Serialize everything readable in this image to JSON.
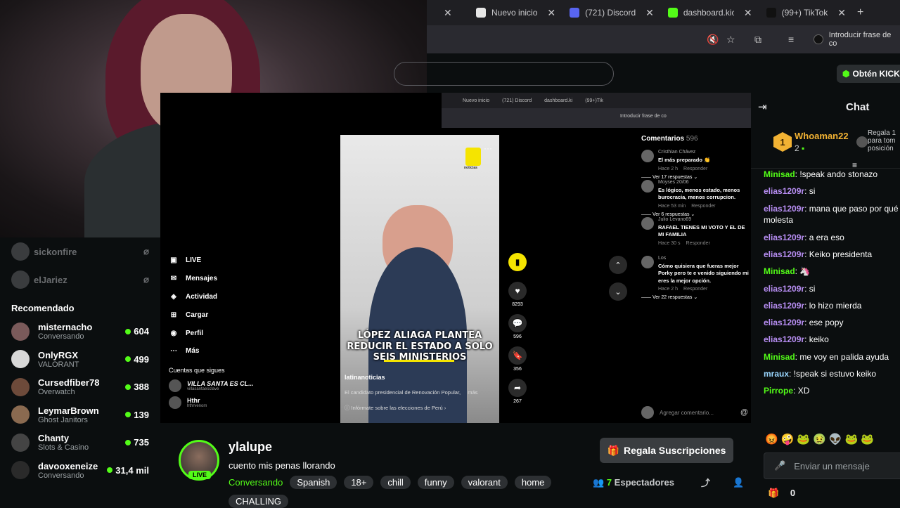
{
  "browser": {
    "tabs": [
      {
        "label": "",
        "color": "#888"
      },
      {
        "label": "Nuevo inicio",
        "color": "#e6e6e6"
      },
      {
        "label": "(721) Discord",
        "color": "#5865f2"
      },
      {
        "label": "dashboard.kick",
        "color": "#53fc18"
      },
      {
        "label": "(99+) TikTok",
        "color": "#111"
      }
    ],
    "new_tab": "+",
    "profile_text": "Introducir frase de co"
  },
  "site": {
    "get_kick": "Obtén KICK"
  },
  "sidebar": {
    "followed": [
      {
        "name": "sickonfire"
      },
      {
        "name": "elJariez"
      }
    ],
    "recommended_title": "Recomendado",
    "recommended": [
      {
        "name": "misternacho",
        "category": "Conversando",
        "viewers": "604"
      },
      {
        "name": "OnlyRGX",
        "category": "VALORANT",
        "viewers": "499"
      },
      {
        "name": "Cursedfiber78",
        "category": "Overwatch",
        "viewers": "388"
      },
      {
        "name": "LeymarBrown",
        "category": "Ghost Janitors",
        "viewers": "139"
      },
      {
        "name": "Chanty",
        "category": "Slots & Casino",
        "viewers": "735"
      },
      {
        "name": "davooxeneize",
        "category": "Conversando",
        "viewers": "31,4 mil"
      }
    ]
  },
  "tiktok": {
    "inner_tabs": [
      "Nuevo inicio",
      "(721) Discord",
      "dashboard.ki",
      "(99+)Tik"
    ],
    "inner_profile": "Introducir frase de co",
    "nav": [
      "LIVE",
      "Mensajes",
      "Actividad",
      "Cargar",
      "Perfil",
      "Más"
    ],
    "following_title": "Cuentas que sigues",
    "following": [
      {
        "name": "VILLA SANTA ES CL...",
        "handle": "villasantaesclave"
      },
      {
        "name": "Hthr",
        "handle": "hthrvenom"
      }
    ],
    "caption": "LÓPEZ ALIAGA PLANTEA REDUCIR EL ESTADO A SOLO SEIS MINISTERIOS",
    "handle": "latinanoticias",
    "description": "El candidato presidencial de Renovación Popular,",
    "description_more": "más",
    "info_link": "Infórmate sobre las elecciones de Perú",
    "logo_text": "noticias",
    "actions": [
      {
        "icon": "heart-icon",
        "count": "8293"
      },
      {
        "icon": "comment-icon",
        "count": "596"
      },
      {
        "icon": "bookmark-icon",
        "count": "356"
      },
      {
        "icon": "share-icon",
        "count": "267"
      }
    ],
    "comments_title": "Comentarios",
    "comments_count": "596",
    "comments": [
      {
        "user": "Cristhian Chávez",
        "text": "El más preparado 👏",
        "meta": "Hace 2 h",
        "reply": "Responder",
        "more": "Ver 17 respuestas"
      },
      {
        "user": "Moyses 20/06",
        "text": "Es lógico, menos estado, menos burocracia, menos corrupcion.",
        "meta": "Hace 53 min",
        "reply": "Responder",
        "more": "Ver 6 respuestas"
      },
      {
        "user": "Julio Levano69",
        "text": "RAFAEL TIENES MI VOTO Y EL DE MI FAMILIA",
        "meta": "Hace 30 s",
        "reply": "Responder",
        "more": ""
      },
      {
        "user": "Los",
        "text": "Cómo quisiera que fueras mejor Porky pero te e venido siguiendo mi eres la mejor opción.",
        "meta": "Hace 2 h",
        "reply": "Responder",
        "more": "Ver 22 respuestas"
      }
    ],
    "add_comment": "Agregar comentario..."
  },
  "stream": {
    "channel": "ylalupe",
    "title": "cuento mis penas llorando",
    "live_label": "LIVE",
    "category": "Conversando",
    "tags": [
      "Spanish",
      "18+",
      "chill",
      "funny",
      "valorant",
      "home"
    ],
    "tag_extra": "CHALLING",
    "subscribe_label": "Regala Suscripciones",
    "viewers_count": "7",
    "viewers_label": "Espectadores"
  },
  "chat": {
    "title": "Chat",
    "pinned_user": "Whoaman22",
    "pinned_rank": "1",
    "pinned_count": "2",
    "pinned_side": "Regala 1 para tom posición",
    "messages": [
      {
        "user": "Minisad",
        "color": "green",
        "text": "!speak ando stonazo"
      },
      {
        "user": "elias1209r",
        "color": "purple",
        "text": "si"
      },
      {
        "user": "elias1209r",
        "color": "purple",
        "text": "mana que paso por qué molesta"
      },
      {
        "user": "elias1209r",
        "color": "purple",
        "text": "a era eso"
      },
      {
        "user": "elias1209r",
        "color": "purple",
        "text": "Keiko presidenta"
      },
      {
        "user": "Minisad",
        "color": "green",
        "text": "🦄"
      },
      {
        "user": "elias1209r",
        "color": "purple",
        "text": "si"
      },
      {
        "user": "elias1209r",
        "color": "purple",
        "text": "lo hizo mierda"
      },
      {
        "user": "elias1209r",
        "color": "purple",
        "text": "ese popy"
      },
      {
        "user": "elias1209r",
        "color": "purple",
        "text": "keiko"
      },
      {
        "user": "Minisad",
        "color": "green",
        "text": "me voy en palida ayuda"
      },
      {
        "user": "mraux",
        "color": "blue",
        "text": "!speak si estuvo keiko"
      },
      {
        "user": "Pirrope",
        "color": "green",
        "text": "XD"
      }
    ],
    "emotes": [
      "😡",
      "🤪",
      "🐸",
      "🤢",
      "👽",
      "🐸",
      "🐸"
    ],
    "input_placeholder": "Enviar un mensaje",
    "footer_count": "0"
  }
}
